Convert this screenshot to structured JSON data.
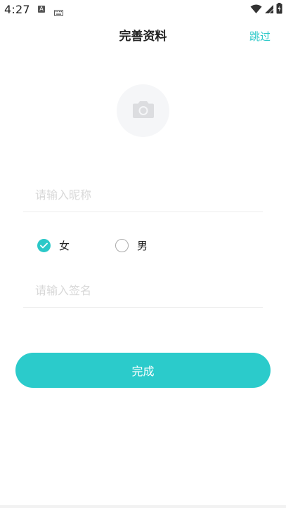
{
  "status_bar": {
    "time": "4:27",
    "notif_a": "A",
    "icons": [
      "wifi-icon",
      "signal-icon",
      "battery-icon"
    ]
  },
  "header": {
    "title": "完善资料",
    "skip_label": "跳过"
  },
  "avatar": {
    "icon": "camera-icon"
  },
  "form": {
    "nickname_placeholder": "请输入昵称",
    "nickname_value": "",
    "gender": {
      "selected": "女",
      "options": [
        {
          "label": "女",
          "checked": true
        },
        {
          "label": "男",
          "checked": false
        }
      ]
    },
    "signature_placeholder": "请输入签名",
    "signature_value": ""
  },
  "submit": {
    "label": "完成"
  },
  "colors": {
    "accent": "#2bc8c8",
    "button": "#2bcbcb",
    "placeholder": "#d8d8d8",
    "divider": "#eeeeee"
  }
}
